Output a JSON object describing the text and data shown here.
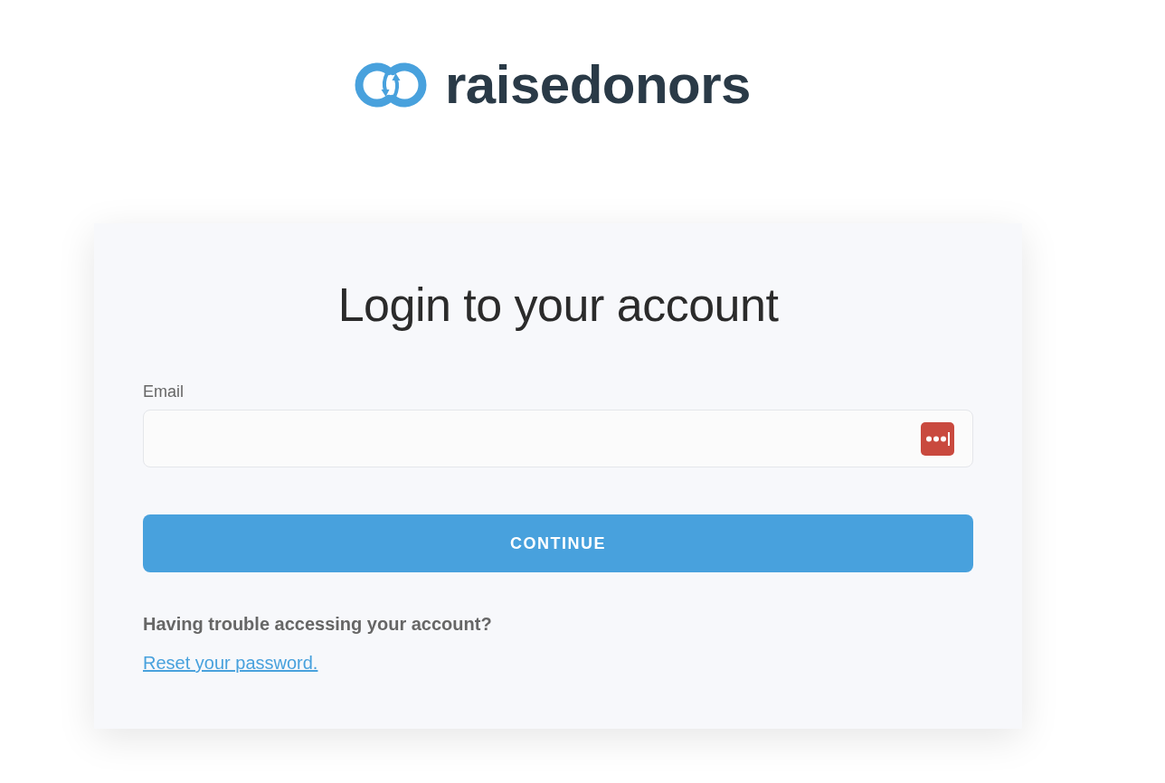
{
  "logo": {
    "text": "raisedonors"
  },
  "login_card": {
    "title": "Login to your account",
    "email_field": {
      "label": "Email"
    },
    "continue_button": {
      "label": "CONTINUE"
    },
    "help": {
      "text": "Having trouble accessing your account?",
      "link": "Reset your password."
    }
  }
}
